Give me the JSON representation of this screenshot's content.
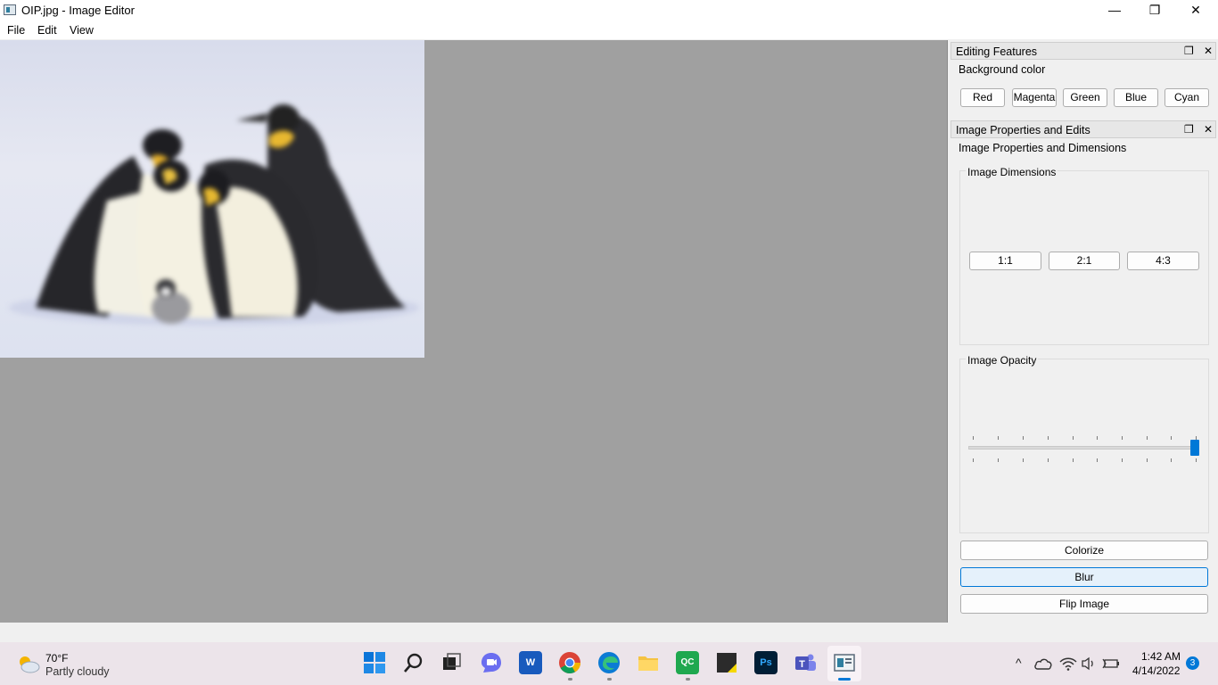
{
  "window": {
    "title": "OIP.jpg - Image Editor",
    "minimize_glyph": "—",
    "restore_glyph": "❐",
    "close_glyph": "✕"
  },
  "menu": [
    "File",
    "Edit",
    "View"
  ],
  "editing_features": {
    "title": "Editing Features",
    "section_label": "Background color",
    "color_buttons": [
      "Red",
      "Magenta",
      "Green",
      "Blue",
      "Cyan"
    ],
    "float_glyph": "❐",
    "close_glyph": "✕"
  },
  "image_properties": {
    "title": "Image Properties and Edits",
    "section_label": "Image Properties and Dimensions",
    "dimensions_group": "Image Dimensions",
    "ratio_buttons": [
      "1:1",
      "2:1",
      "4:3"
    ],
    "opacity_group": "Image Opacity",
    "opacity_value": 1.0,
    "actions": [
      "Colorize",
      "Blur",
      "Flip Image"
    ],
    "float_glyph": "❐",
    "close_glyph": "✕"
  },
  "taskbar": {
    "weather_temp": "70°F",
    "weather_desc": "Partly cloudy",
    "time": "1:42 AM",
    "date": "4/14/2022",
    "notification_count": "3",
    "apps": [
      "start-icon",
      "search-icon",
      "task-view-icon",
      "chat-icon",
      "word-icon",
      "chrome-icon",
      "edge-icon",
      "file-explorer-icon",
      "qc-icon",
      "sticky-notes-icon",
      "photoshop-icon",
      "teams-icon",
      "image-editor-icon"
    ],
    "app_labels": {
      "word": "W",
      "qc": "QC",
      "photoshop": "Ps"
    }
  },
  "colors": {
    "canvas": "#a0a0a0",
    "accent": "#0078d7"
  }
}
